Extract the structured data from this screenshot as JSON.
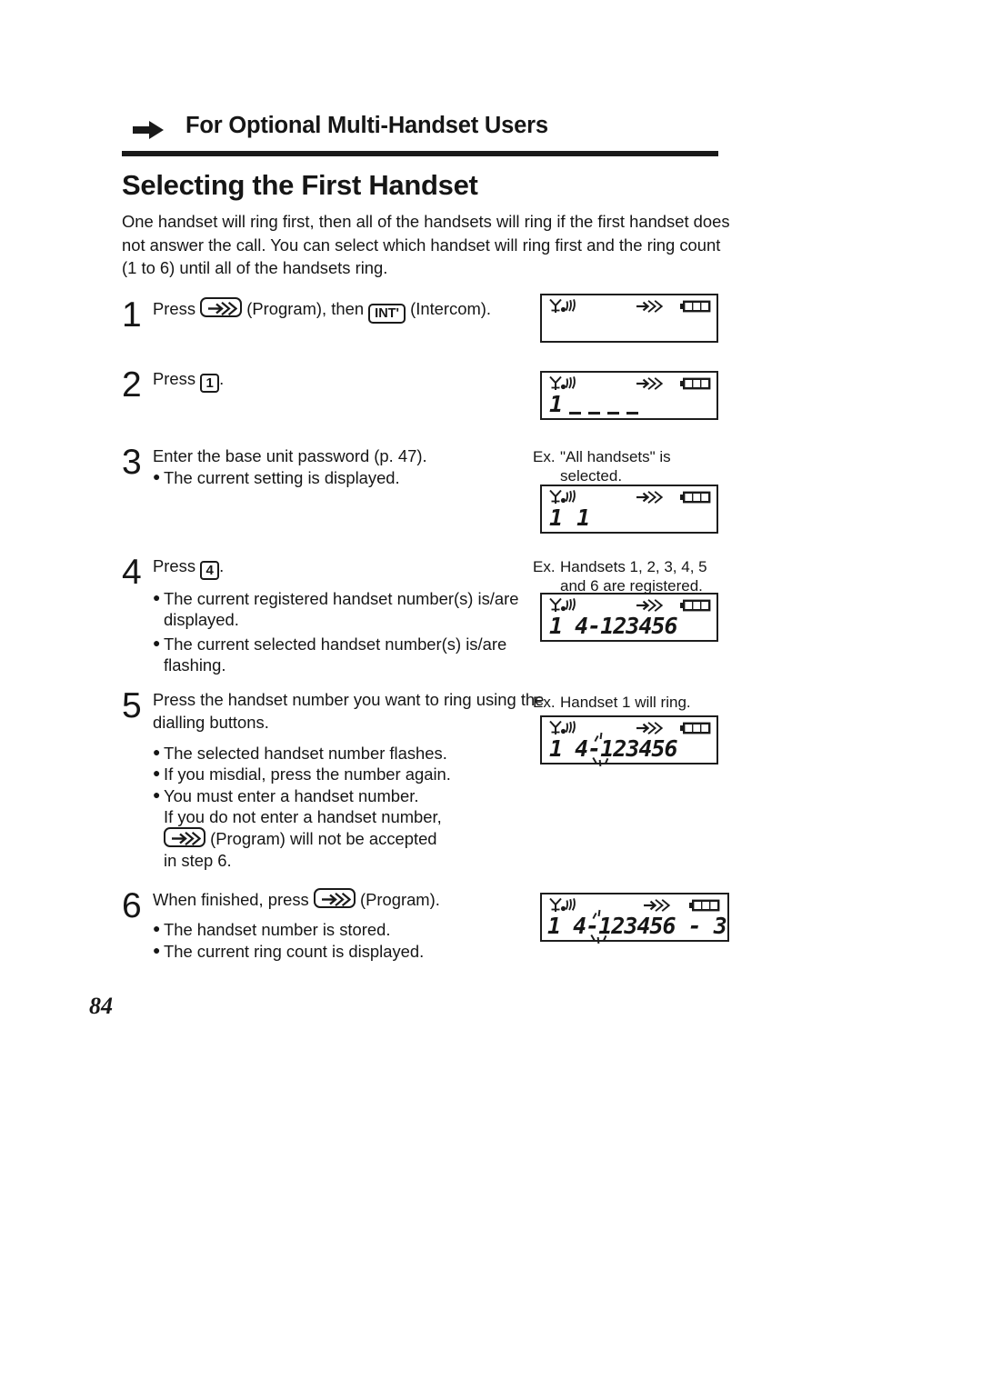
{
  "header": {
    "arrow_icon": "right-arrow-icon",
    "title": "For Optional Multi-Handset Users"
  },
  "section": {
    "title": "Selecting the First Handset",
    "intro": "One handset will ring first, then all of the handsets will ring if the first handset does not answer the call. You can select which handset will ring first and the ring count (1 to 6) until all of the handsets ring."
  },
  "steps": [
    {
      "number": "1",
      "lead_a": "Press",
      "key_program": "program-icon",
      "lead_b": "(Program), then",
      "key_int": "INT'",
      "lead_c": "(Intercom).",
      "bullets": []
    },
    {
      "number": "2",
      "lead_a": "Press",
      "key_digit": "1",
      "lead_b": ".",
      "bullets": []
    },
    {
      "number": "3",
      "lead": "Enter the base unit password (p. 47).",
      "bullets": [
        "The current setting is displayed."
      ]
    },
    {
      "number": "4",
      "lead_a": "Press",
      "key_digit": "4",
      "lead_b": ".",
      "bullets": [
        "The current registered handset number(s) is/are displayed.",
        "The current selected handset number(s) is/are flashing."
      ]
    },
    {
      "number": "5",
      "lead": "Press the handset number you want to ring using the dialling buttons.",
      "bullets": [
        "The selected handset number flashes.",
        "If you misdial, press the number again.",
        "You must enter a handset number."
      ],
      "bullet3_line2": "If you do not enter a handset number,",
      "bullet3_line3_a": "(Program) will not be accepted",
      "bullet3_line4": "in step 6."
    },
    {
      "number": "6",
      "lead_a": "When finished, press",
      "key_program": "program-icon",
      "lead_b": "(Program).",
      "bullets": [
        "The handset number is stored.",
        "The current ring count is displayed."
      ]
    }
  ],
  "examples": {
    "step3": {
      "label": "Ex.",
      "text": "\"All handsets\" is selected."
    },
    "step4": {
      "label": "Ex.",
      "text": "Handsets 1, 2, 3, 4, 5 and 6 are registered."
    },
    "step5": {
      "label": "Ex.",
      "text": "Handset 1 will ring."
    }
  },
  "lcd": {
    "icons": {
      "antenna": "antenna-signal-icon",
      "program": "program-arrow-icon",
      "battery": "battery-full-icon"
    },
    "screens": {
      "step1": {
        "text": ""
      },
      "step2": {
        "digit": "1",
        "dashes": 4
      },
      "step3": {
        "text": "1  1"
      },
      "step4": {
        "text": "1 4-123456"
      },
      "step5": {
        "prefix": "1 4-",
        "flashing": "1",
        "suffix": "23456"
      },
      "step6": {
        "prefix": "1 4-",
        "flashing": "1",
        "suffix": "23456 - 3"
      }
    }
  },
  "page_number": "84"
}
